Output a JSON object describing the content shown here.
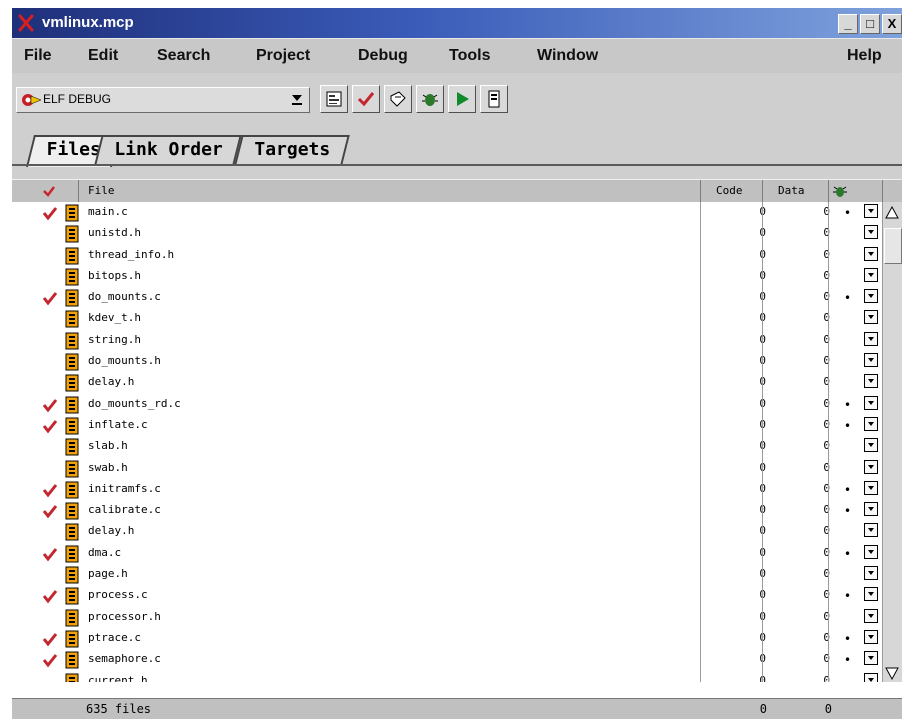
{
  "window": {
    "title": "vmlinux.mcp",
    "controls": {
      "minimize": "_",
      "maximize": "□",
      "close": "X"
    }
  },
  "menu": {
    "file": "File",
    "edit": "Edit",
    "search": "Search",
    "project": "Project",
    "debug": "Debug",
    "tools": "Tools",
    "window": "Window",
    "help": "Help"
  },
  "toolbar": {
    "target": "ELF DEBUG",
    "buttons": [
      {
        "name": "settings-button",
        "icon": "settings-icon"
      },
      {
        "name": "synchronize-modification-dates-button",
        "icon": "check-icon"
      },
      {
        "name": "make-button",
        "icon": "make-icon"
      },
      {
        "name": "debug-button",
        "icon": "debug-icon"
      },
      {
        "name": "run-button",
        "icon": "play-icon"
      },
      {
        "name": "project-inspector-button",
        "icon": "inspector-icon"
      }
    ]
  },
  "tabs": {
    "files": "Files",
    "link_order": "Link Order",
    "targets": "Targets"
  },
  "columns": {
    "file": "File",
    "code": "Code",
    "data": "Data"
  },
  "files": [
    {
      "name": "main.c",
      "touched": true,
      "code": "0",
      "data": "0",
      "debug": true
    },
    {
      "name": "unistd.h",
      "touched": false,
      "code": "0",
      "data": "0",
      "debug": false
    },
    {
      "name": "thread_info.h",
      "touched": false,
      "code": "0",
      "data": "0",
      "debug": false
    },
    {
      "name": "bitops.h",
      "touched": false,
      "code": "0",
      "data": "0",
      "debug": false
    },
    {
      "name": "do_mounts.c",
      "touched": true,
      "code": "0",
      "data": "0",
      "debug": true
    },
    {
      "name": "kdev_t.h",
      "touched": false,
      "code": "0",
      "data": "0",
      "debug": false
    },
    {
      "name": "string.h",
      "touched": false,
      "code": "0",
      "data": "0",
      "debug": false
    },
    {
      "name": "do_mounts.h",
      "touched": false,
      "code": "0",
      "data": "0",
      "debug": false
    },
    {
      "name": "delay.h",
      "touched": false,
      "code": "0",
      "data": "0",
      "debug": false
    },
    {
      "name": "do_mounts_rd.c",
      "touched": true,
      "code": "0",
      "data": "0",
      "debug": true
    },
    {
      "name": "inflate.c",
      "touched": true,
      "code": "0",
      "data": "0",
      "debug": true
    },
    {
      "name": "slab.h",
      "touched": false,
      "code": "0",
      "data": "0",
      "debug": false
    },
    {
      "name": "swab.h",
      "touched": false,
      "code": "0",
      "data": "0",
      "debug": false
    },
    {
      "name": "initramfs.c",
      "touched": true,
      "code": "0",
      "data": "0",
      "debug": true
    },
    {
      "name": "calibrate.c",
      "touched": true,
      "code": "0",
      "data": "0",
      "debug": true
    },
    {
      "name": "delay.h",
      "touched": false,
      "code": "0",
      "data": "0",
      "debug": false
    },
    {
      "name": "dma.c",
      "touched": true,
      "code": "0",
      "data": "0",
      "debug": true
    },
    {
      "name": "page.h",
      "touched": false,
      "code": "0",
      "data": "0",
      "debug": false
    },
    {
      "name": "process.c",
      "touched": true,
      "code": "0",
      "data": "0",
      "debug": true
    },
    {
      "name": "processor.h",
      "touched": false,
      "code": "0",
      "data": "0",
      "debug": false
    },
    {
      "name": "ptrace.c",
      "touched": true,
      "code": "0",
      "data": "0",
      "debug": true
    },
    {
      "name": "semaphore.c",
      "touched": true,
      "code": "0",
      "data": "0",
      "debug": true
    },
    {
      "name": "current.h",
      "touched": false,
      "code": "0",
      "data": "0",
      "debug": false
    }
  ],
  "footer": {
    "count": "635 files",
    "code_total": "0",
    "data_total": "0"
  },
  "colors": {
    "title_start": "#1f2f7a",
    "title_end": "#7fa2dd",
    "check_red": "#c3262e",
    "file_icon": "#f0a00c"
  }
}
